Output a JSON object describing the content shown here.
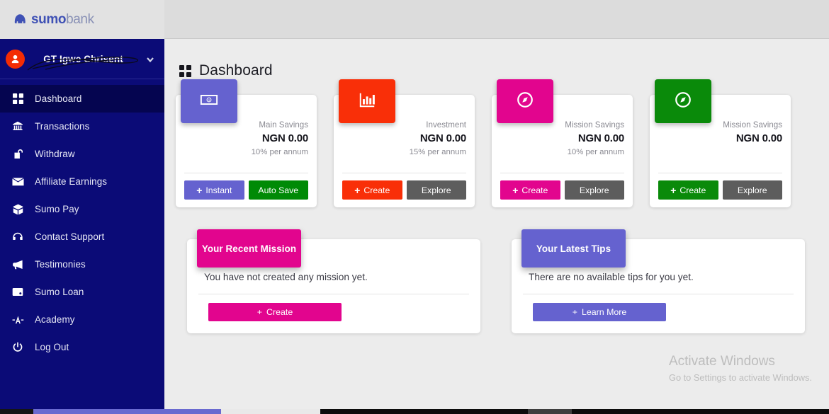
{
  "brand": {
    "name_bold": "sumo",
    "name_light": "bank"
  },
  "user": {
    "name": "GT Igwe Chrisent"
  },
  "sidebar": {
    "items": [
      {
        "label": "Dashboard",
        "icon": "grid-icon",
        "active": true
      },
      {
        "label": "Transactions",
        "icon": "bank-icon",
        "active": false
      },
      {
        "label": "Withdraw",
        "icon": "unlock-icon",
        "active": false
      },
      {
        "label": "Affiliate Earnings",
        "icon": "envelope-icon",
        "active": false
      },
      {
        "label": "Sumo Pay",
        "icon": "box-icon",
        "active": false
      },
      {
        "label": "Contact Support",
        "icon": "headset-icon",
        "active": false
      },
      {
        "label": "Testimonies",
        "icon": "megaphone-icon",
        "active": false
      },
      {
        "label": "Sumo Loan",
        "icon": "wallet-icon",
        "active": false
      },
      {
        "label": "Academy",
        "icon": "tower-icon",
        "active": false
      },
      {
        "label": "Log Out",
        "icon": "power-icon",
        "active": false
      }
    ]
  },
  "page": {
    "title": "Dashboard",
    "icon": "grid-icon"
  },
  "cards": [
    {
      "label": "Main Savings",
      "amount": "NGN 0.00",
      "rate": "10% per annum",
      "color": "#6562cf",
      "icon": "money-bill-icon",
      "primary": {
        "label": "Instant",
        "plus": "+",
        "color": "#6562cf"
      },
      "secondary": {
        "label": "Auto Save",
        "color": "#008a06"
      }
    },
    {
      "label": "Investment",
      "amount": "NGN 0.00",
      "rate": "15% per annum",
      "color": "#f92f08",
      "icon": "bar-chart-icon",
      "primary": {
        "label": "Create",
        "plus": "+",
        "color": "#f92f08"
      },
      "secondary": {
        "label": "Explore",
        "color": "#5d5d5d"
      }
    },
    {
      "label": "Mission Savings",
      "amount": "NGN 0.00",
      "rate": "10% per annum",
      "color": "#e2058e",
      "icon": "compass-icon",
      "primary": {
        "label": "Create",
        "plus": "+",
        "color": "#e2058e"
      },
      "secondary": {
        "label": "Explore",
        "color": "#5d5d5d"
      }
    },
    {
      "label": "Mission Savings",
      "amount": "NGN 0.00",
      "rate": "",
      "color": "#0a8a0a",
      "icon": "compass-icon",
      "primary": {
        "label": "Create",
        "plus": "+",
        "color": "#0a8a0a"
      },
      "secondary": {
        "label": "Explore",
        "color": "#5d5d5d"
      }
    }
  ],
  "panels": [
    {
      "title": "Your Recent Mission",
      "title_color": "#e2058e",
      "text": "You have not created any mission yet.",
      "button": {
        "label": "Create",
        "plus": "+",
        "color": "#e2058e"
      }
    },
    {
      "title": "Your Latest Tips",
      "title_color": "#6562cf",
      "text": "There are no available tips for you yet.",
      "button": {
        "label": "Learn More",
        "plus": "+",
        "color": "#6562cf"
      }
    }
  ],
  "watermark": {
    "line1": "Activate Windows",
    "line2": "Go to Settings to activate Windows."
  }
}
